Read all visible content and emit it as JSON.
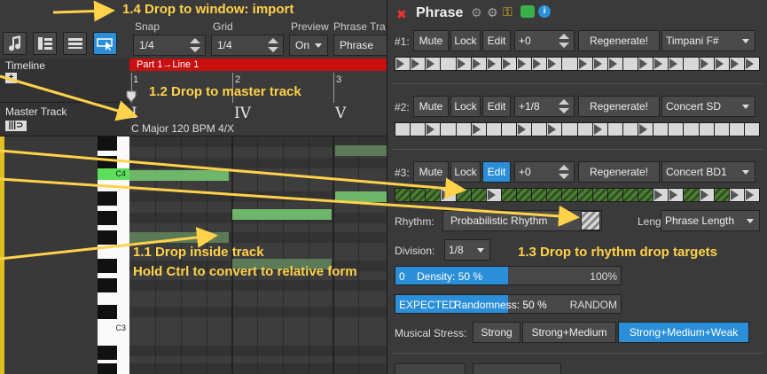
{
  "toolbar": {
    "snap_label": "Snap",
    "snap_value": "1/4",
    "grid_label": "Grid",
    "grid_value": "1/4",
    "preview_label": "Preview",
    "preview_value": "On",
    "phrase_type_label": "Phrase Tra",
    "phrase_type_value": "Phrase"
  },
  "left": {
    "timeline_label": "Timeline",
    "master_track_label": "Master Track"
  },
  "timeline": {
    "part_label": "Part 1→Line 1",
    "bars": [
      "1",
      "2",
      "3"
    ]
  },
  "master": {
    "chords": [
      "I",
      "IV",
      "V"
    ],
    "key_info": "C Major  120 BPM  4/X"
  },
  "piano": {
    "c4": "C4",
    "c3": "C3"
  },
  "phrase": {
    "title": "Phrase",
    "rows": [
      {
        "label": "#1:",
        "mute": "Mute",
        "lock": "Lock",
        "edit": "Edit",
        "offset": "+0",
        "regen": "Regenerate!",
        "instrument": "Timpani F#"
      },
      {
        "label": "#2:",
        "mute": "Mute",
        "lock": "Lock",
        "edit": "Edit",
        "offset": "+1/8",
        "regen": "Regenerate!",
        "instrument": "Concert SD"
      },
      {
        "label": "#3:",
        "mute": "Mute",
        "lock": "Lock",
        "edit": "Edit",
        "offset": "+0",
        "regen": "Regenerate!",
        "instrument": "Concert BD1"
      }
    ],
    "rhythm_label": "Rhythm:",
    "rhythm_value": "Probabilistic Rhythm",
    "length_label": "Length:",
    "length_value": "Phrase Length",
    "division_label": "Division:",
    "division_value": "1/8",
    "density_min": "0",
    "density_text": "Density: 50 %",
    "density_max": "100%",
    "density_fraction": 0.5,
    "randomness_left": "EXPECTED",
    "randomness_text": "Randomness: 50 %",
    "randomness_right": "RANDOM",
    "randomness_fraction": 0.5,
    "stress_label": "Musical Stress:",
    "stress_options": [
      "Strong",
      "Strong+Medium",
      "Strong+Medium+Weak"
    ]
  },
  "annotations": {
    "a14": "1.4 Drop to window: import",
    "a12": "1.2 Drop to master track",
    "a11": "1.1 Drop inside track",
    "a11b": "Hold Ctrl to convert to relative form",
    "a13": "1.3 Drop to rhythm drop targets"
  },
  "colors": {
    "accent": "#2a8fd8",
    "part_bar": "#c81010",
    "note": "#6fb56a",
    "annotation": "#ffd24a"
  }
}
